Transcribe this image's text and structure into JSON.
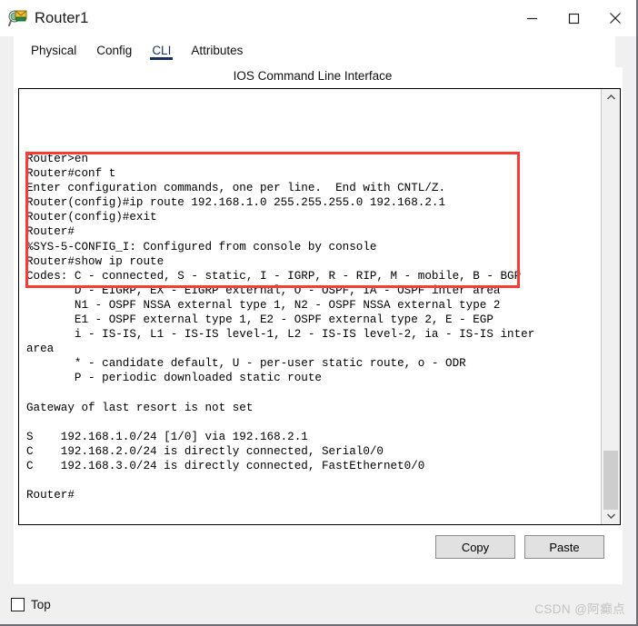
{
  "window": {
    "title": "Router1",
    "icon": "router-device-icon",
    "minimize_label": "—",
    "maximize_label": "□",
    "close_label": "✕"
  },
  "tabs": [
    {
      "label": "Physical",
      "active": false
    },
    {
      "label": "Config",
      "active": false
    },
    {
      "label": "CLI",
      "active": true
    },
    {
      "label": "Attributes",
      "active": false
    }
  ],
  "panel": {
    "heading": "IOS Command Line Interface"
  },
  "terminal": {
    "highlighted_block": "Router>en\nRouter#conf t\nEnter configuration commands, one per line.  End with CNTL/Z.\nRouter(config)#ip route 192.168.1.0 255.255.255.0 192.168.2.1\nRouter(config)#exit\nRouter#\n%SYS-5-CONFIG_I: Configured from console by console\n",
    "output_block": "Router#show ip route\nCodes: C - connected, S - static, I - IGRP, R - RIP, M - mobile, B - BGP\n       D - EIGRP, EX - EIGRP external, O - OSPF, IA - OSPF inter area\n       N1 - OSPF NSSA external type 1, N2 - OSPF NSSA external type 2\n       E1 - OSPF external type 1, E2 - OSPF external type 2, E - EGP\n       i - IS-IS, L1 - IS-IS level-1, L2 - IS-IS level-2, ia - IS-IS inter\narea\n       * - candidate default, U - per-user static route, o - ODR\n       P - periodic downloaded static route\n\nGateway of last resort is not set\n\nS    192.168.1.0/24 [1/0] via 192.168.2.1\nC    192.168.2.0/24 is directly connected, Serial0/0\nC    192.168.3.0/24 is directly connected, FastEthernet0/0\n\nRouter#"
  },
  "buttons": {
    "copy": "Copy",
    "paste": "Paste"
  },
  "footer": {
    "top_checkbox_label": "Top",
    "top_checkbox_checked": false,
    "watermark": "CSDN @阿癫点"
  },
  "colors": {
    "accent": "#16325c",
    "annotation": "#fb3b31",
    "scrollbar_thumb": "#cdcdcd",
    "button_face": "#e1e1e1"
  }
}
